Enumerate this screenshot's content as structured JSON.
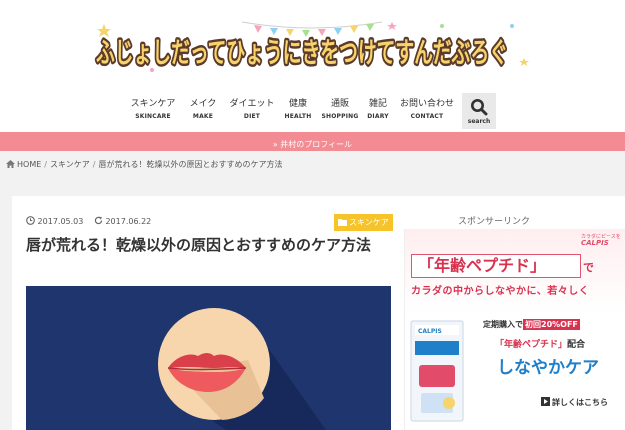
{
  "site": {
    "logo_text": "ふじょしだってひょうにきをつけてすんだぶろぐ"
  },
  "nav": {
    "items": [
      {
        "ja": "スキンケア",
        "en": "SKINCARE"
      },
      {
        "ja": "メイク",
        "en": "MAKE"
      },
      {
        "ja": "ダイエット",
        "en": "DIET"
      },
      {
        "ja": "健康",
        "en": "HEALTH"
      },
      {
        "ja": "通販",
        "en": "SHOPPING"
      },
      {
        "ja": "雑記",
        "en": "DIARY"
      },
      {
        "ja": "お問い合わせ",
        "en": "CONTACT"
      }
    ],
    "search_label": "search"
  },
  "profile_bar": {
    "label": "» 井村のプロフィール"
  },
  "breadcrumb": {
    "home": "HOME",
    "sep": "/",
    "category": "スキンケア",
    "current": "唇が荒れる！乾燥以外の原因とおすすめのケア方法"
  },
  "article": {
    "published": "2017.05.03",
    "updated": "2017.06.22",
    "category_badge": "スキンケア",
    "title": "唇が荒れる！乾燥以外の原因とおすすめのケア方法"
  },
  "sidebar": {
    "sponsor_label": "スポンサーリンク",
    "ad": {
      "brand_ja": "カラダにピースを",
      "brand": "CALPIS",
      "product_quote": "「年齢ペプチド」",
      "particle": "で",
      "subline": "カラダの中からしなやかに、若々しく",
      "promo_prefix": "定期購入で",
      "promo_highlight": "初回20%OFF",
      "promo2_highlight": "「年齢ペプチド」",
      "promo2_suffix": "配合",
      "product_name": "しなやかケア",
      "more": "詳しくはこちら"
    }
  },
  "colors": {
    "accent_pink": "#f38b93",
    "badge_yellow": "#f6c42a",
    "eyecatch_navy": "#1f356e",
    "ad_red": "#d8324f",
    "ad_blue": "#1f7fc9"
  }
}
